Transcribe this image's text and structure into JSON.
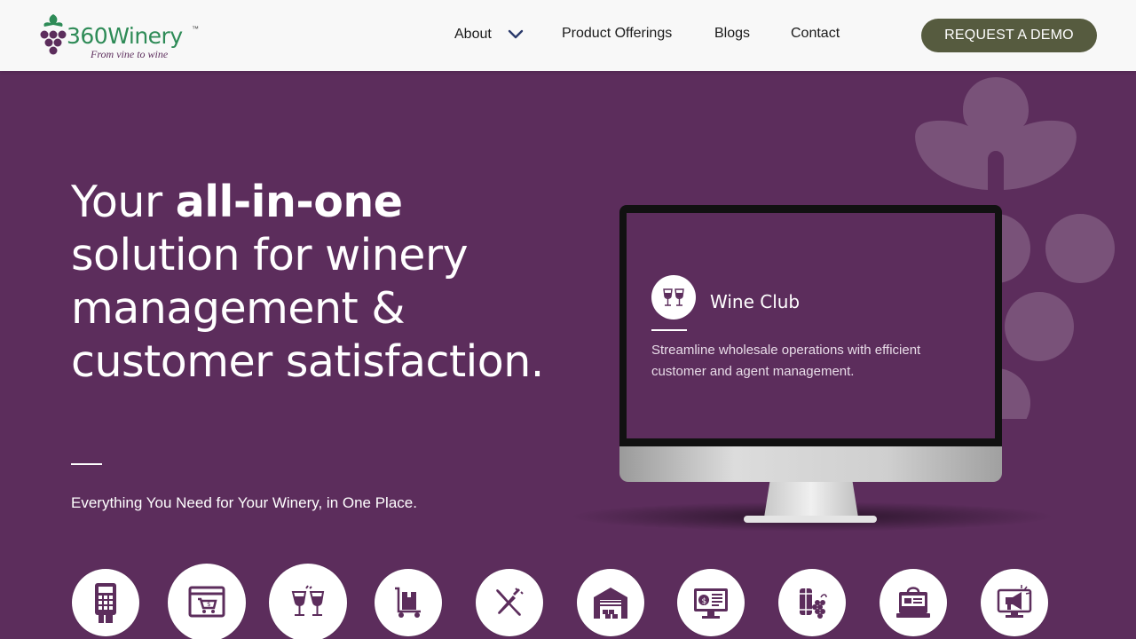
{
  "brand": {
    "name_number": "360",
    "name_word": "Winery",
    "trademark": "™",
    "tagline": "From vine to wine"
  },
  "nav": {
    "items": [
      {
        "label": "About",
        "has_dropdown": true
      },
      {
        "label": "Product Offerings"
      },
      {
        "label": "Blogs"
      },
      {
        "label": "Contact"
      }
    ],
    "cta_label": "REQUEST A DEMO"
  },
  "hero": {
    "title_pre": "Your ",
    "title_bold": "all-in-one",
    "title_post": " solution for winery management & customer satisfaction.",
    "subtitle": "Everything You Need for Your Winery, in One Place."
  },
  "monitor_card": {
    "icon": "wine-glasses-icon",
    "title": "Wine Club",
    "description": "Streamline wholesale operations with efficient customer and agent management."
  },
  "features": [
    {
      "icon": "pos-terminal-icon"
    },
    {
      "icon": "ecommerce-cart-icon"
    },
    {
      "icon": "wine-club-glasses-icon"
    },
    {
      "icon": "hand-truck-box-icon"
    },
    {
      "icon": "fork-knife-icon"
    },
    {
      "icon": "warehouse-icon"
    },
    {
      "icon": "billing-monitor-icon"
    },
    {
      "icon": "grape-barrel-icon"
    },
    {
      "icon": "pos-register-icon"
    },
    {
      "icon": "marketing-megaphone-icon"
    }
  ],
  "colors": {
    "primary": "#5c2d5c",
    "cta": "#565b3f",
    "header_bg": "#f8f8f8",
    "logo_green": "#2e8b57"
  }
}
